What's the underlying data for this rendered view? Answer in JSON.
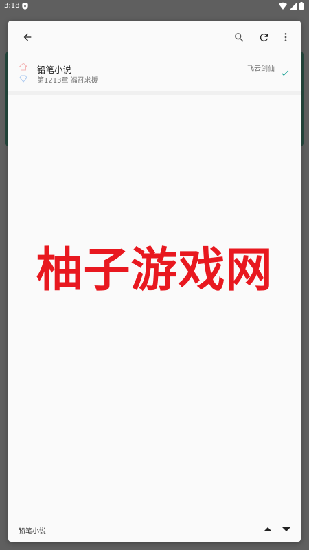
{
  "status_bar": {
    "time": "3:18",
    "icons": [
      "shield-icon",
      "wifi-icon",
      "signal-icon",
      "battery-icon"
    ]
  },
  "toolbar": {
    "icons": [
      "back-arrow-icon",
      "search-icon",
      "refresh-icon",
      "more-vert-icon"
    ]
  },
  "list": {
    "items": [
      {
        "title": "铅笔小说",
        "subtitle": "第1213章 福召求援",
        "author": "飞云剑仙",
        "selected": true
      }
    ]
  },
  "watermark": {
    "text": "柚子游戏网",
    "color": "#e8181f"
  },
  "bottom_bar": {
    "label": "铅笔小说",
    "icons": [
      "arrow-up-icon",
      "arrow-down-icon"
    ]
  },
  "colors": {
    "accent": "#26a69a",
    "background_card": "#25493f",
    "dialog": "#fafafa"
  }
}
